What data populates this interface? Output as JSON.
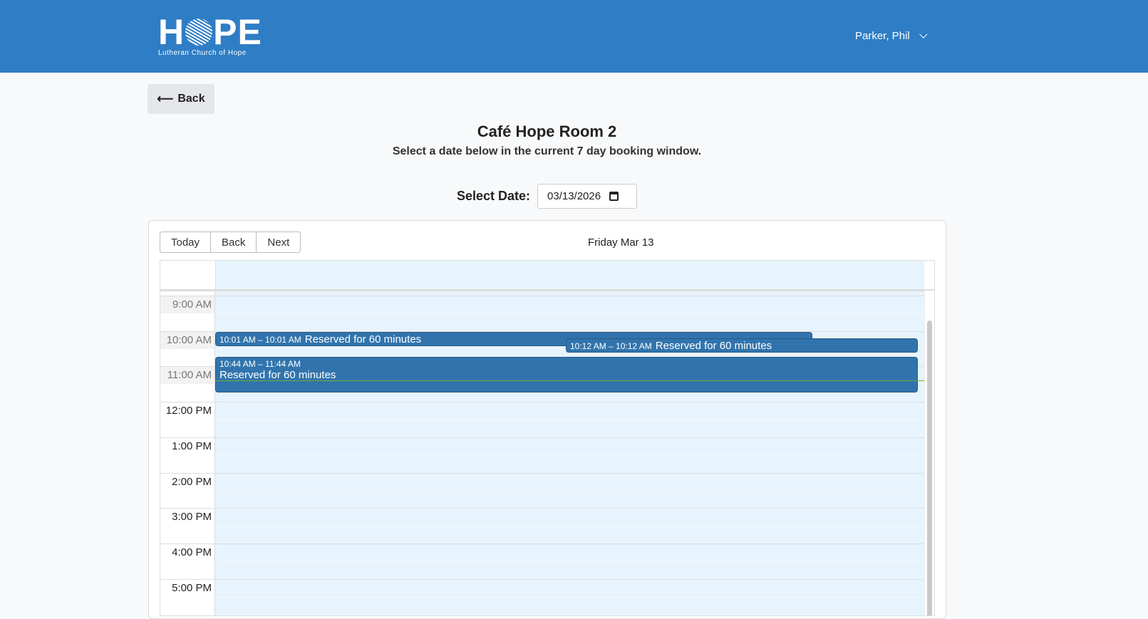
{
  "header": {
    "logo_text_left": "H",
    "logo_text_right": "PE",
    "logo_subtitle": "Lutheran Church of Hope",
    "user_name": "Parker, Phil"
  },
  "back_label": "Back",
  "page": {
    "title": "Café Hope Room 2",
    "subtitle": "Select a date below in the current 7 day booking window.",
    "select_date_label": "Select Date:",
    "date_value": "03/13/2026"
  },
  "calendar": {
    "toolbar": [
      "Today",
      "Back",
      "Next"
    ],
    "day_label": "Friday Mar 13",
    "hours": [
      "9:00 AM",
      "10:00 AM",
      "11:00 AM",
      "12:00 PM",
      "1:00 PM",
      "2:00 PM",
      "3:00 PM",
      "4:00 PM",
      "5:00 PM"
    ],
    "events": [
      {
        "time": "10:01 AM – 10:01 AM",
        "title": "Reserved for 60 minutes"
      },
      {
        "time": "10:12 AM – 10:12 AM",
        "title": "Reserved for 60 minutes"
      },
      {
        "time": "10:44 AM – 11:44 AM",
        "title": "Reserved for 60 minutes"
      }
    ]
  }
}
